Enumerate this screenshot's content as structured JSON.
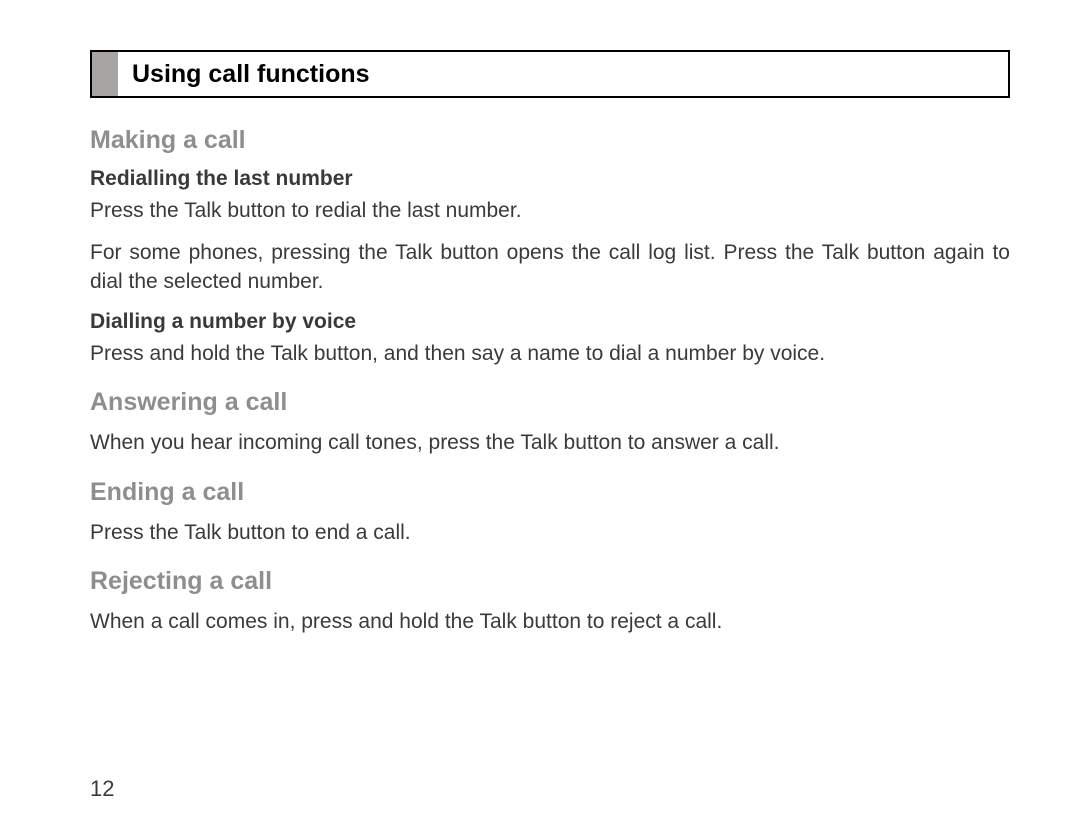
{
  "title": "Using call functions",
  "sections": [
    {
      "heading": "Making a call",
      "subsections": [
        {
          "subheading": "Redialling the last number",
          "paragraphs": [
            "Press the Talk button to redial the last number.",
            "For some phones, pressing the Talk button opens the call log list. Press the Talk button again to dial the selected number."
          ]
        },
        {
          "subheading": "Dialling a number by voice",
          "paragraphs": [
            "Press and hold the Talk button, and then say a name to dial a number by voice."
          ]
        }
      ]
    },
    {
      "heading": "Answering a call",
      "paragraphs": [
        "When you hear incoming call tones, press the Talk button to answer a call."
      ]
    },
    {
      "heading": "Ending a call",
      "paragraphs": [
        "Press the Talk button to end a call."
      ]
    },
    {
      "heading": "Rejecting a call",
      "paragraphs": [
        "When a call comes in, press and hold the Talk button to reject a call."
      ]
    }
  ],
  "pageNumber": "12"
}
